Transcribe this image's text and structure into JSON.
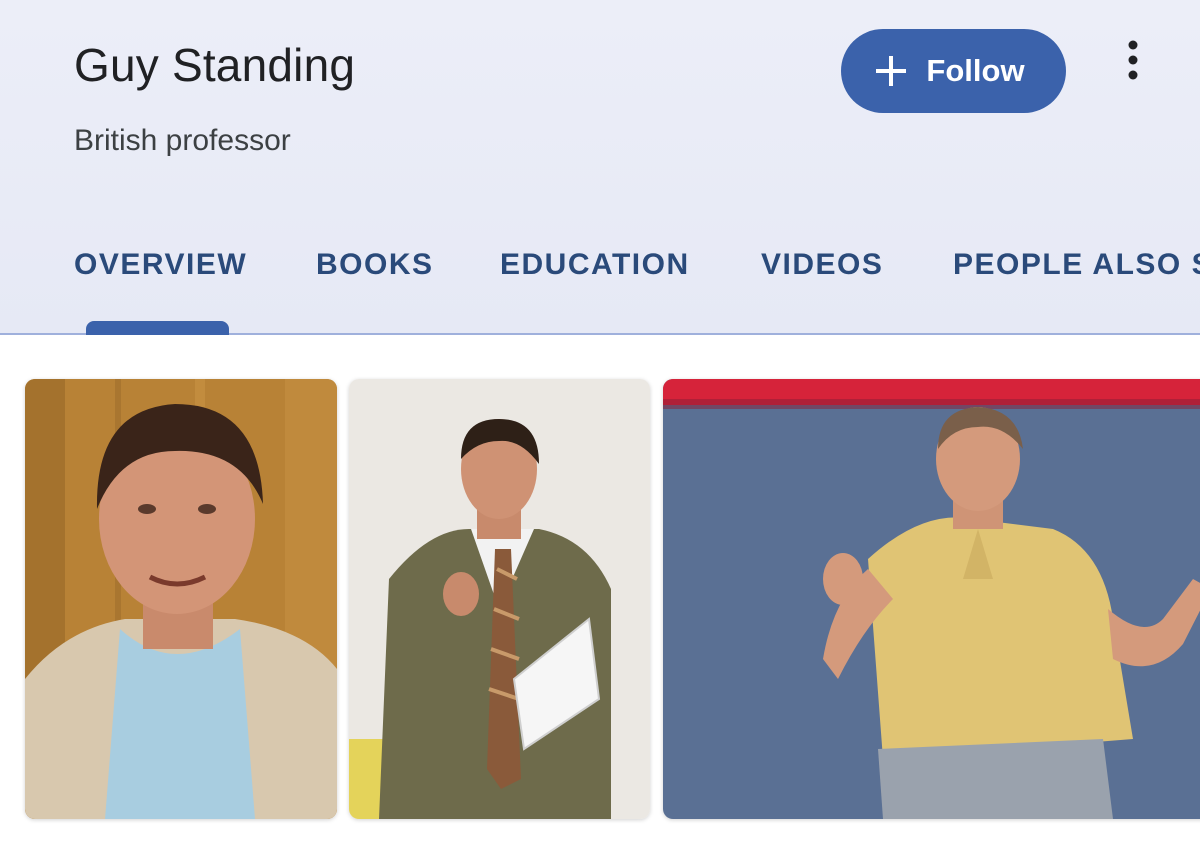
{
  "entity": {
    "name": "Guy Standing",
    "description": "British professor"
  },
  "actions": {
    "follow_label": "Follow",
    "follow_icon": "plus-icon",
    "more_icon": "more-vertical-icon"
  },
  "tabs": [
    {
      "label": "OVERVIEW",
      "selected": true
    },
    {
      "label": "BOOKS",
      "selected": false
    },
    {
      "label": "EDUCATION",
      "selected": false
    },
    {
      "label": "VIDEOS",
      "selected": false
    },
    {
      "label": "PEOPLE ALSO S",
      "selected": false
    }
  ],
  "colors": {
    "accent": "#3b62ab",
    "header_bg": "#e8ebf6",
    "tab_text": "#2a4a7a"
  }
}
